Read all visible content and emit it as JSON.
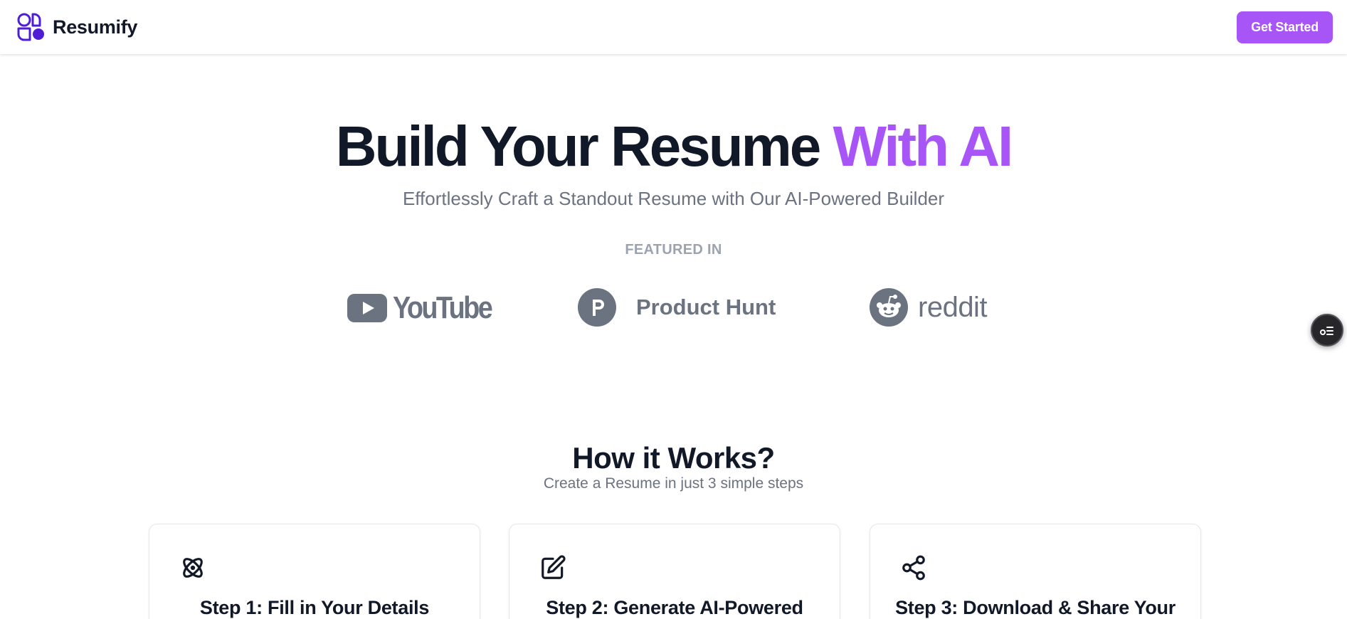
{
  "navbar": {
    "brand_name": "Resumify",
    "brand_icon": "resumify-logo-icon",
    "cta_label": "Get Started",
    "accent_color": "#a855f7"
  },
  "hero": {
    "title_main": "Build Your Resume ",
    "title_accent": "With AI",
    "subtitle": "Effortlessly Craft a Standout Resume with Our AI-Powered Builder",
    "featured_label": "FEATURED IN"
  },
  "featured_logos": [
    {
      "icon": "youtube-icon",
      "label": "YouTube"
    },
    {
      "icon": "product-hunt-icon",
      "label": "Product Hunt"
    },
    {
      "icon": "reddit-icon",
      "label": "reddit"
    }
  ],
  "floating_button": {
    "icon": "toggle-list-icon"
  },
  "how_it_works": {
    "title": "How it Works?",
    "subtitle": "Create a Resume in just 3 simple steps",
    "steps": [
      {
        "icon": "atom-icon",
        "title": "Step 1: Fill in Your Details"
      },
      {
        "icon": "edit-icon",
        "title": "Step 2: Generate AI-Powered"
      },
      {
        "icon": "share-icon",
        "title": "Step 3: Download & Share Your"
      }
    ]
  }
}
